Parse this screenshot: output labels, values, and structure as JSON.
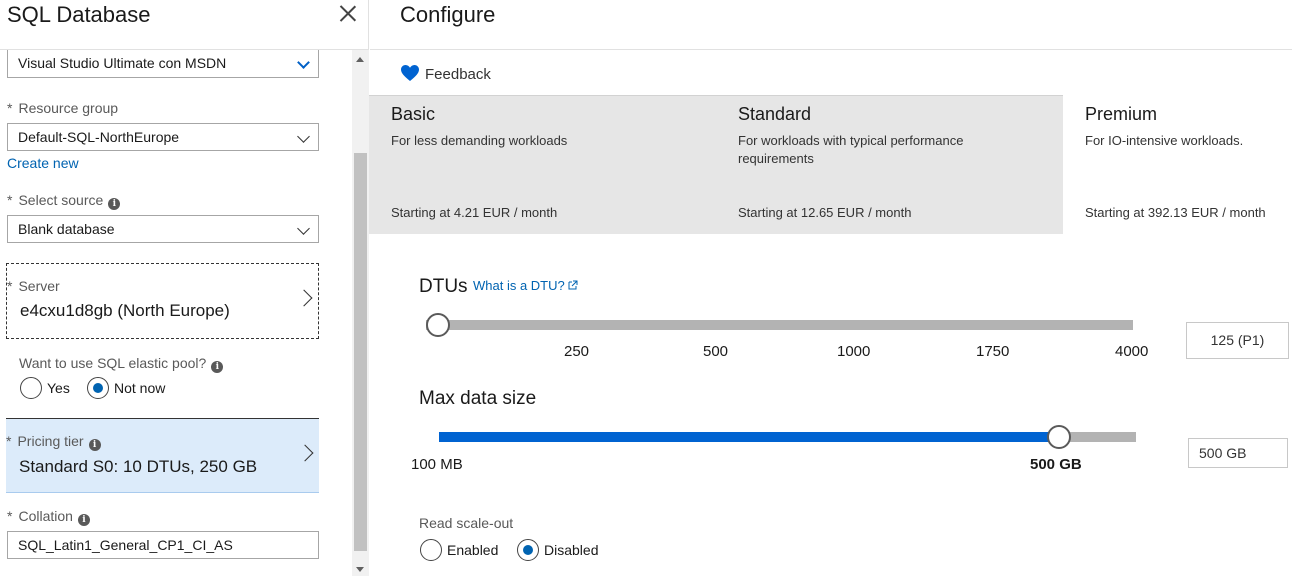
{
  "left_blade": {
    "title": "SQL Database",
    "subscription_value": "Visual Studio Ultimate con MSDN",
    "resource_group": {
      "label": "Resource group",
      "value": "Default-SQL-NorthEurope",
      "create_new": "Create new"
    },
    "select_source": {
      "label": "Select source",
      "value": "Blank database"
    },
    "server": {
      "label": "Server",
      "value": "e4cxu1d8gb (North Europe)"
    },
    "elastic_pool": {
      "label": "Want to use SQL elastic pool?",
      "options": [
        "Yes",
        "Not now"
      ],
      "selected": "Not now"
    },
    "pricing_tier": {
      "label": "Pricing tier",
      "value": "Standard S0: 10 DTUs, 250 GB"
    },
    "collation": {
      "label": "Collation",
      "value": "SQL_Latin1_General_CP1_CI_AS"
    },
    "required_marker": "*"
  },
  "right_blade": {
    "title": "Configure",
    "feedback_label": "Feedback",
    "tiers": [
      {
        "name": "Basic",
        "description": "For less demanding workloads",
        "price": "Starting at 4.21 EUR / month"
      },
      {
        "name": "Standard",
        "description": "For workloads with typical performance requirements",
        "price": "Starting at 12.65 EUR / month"
      },
      {
        "name": "Premium",
        "description": "For IO-intensive workloads.",
        "price": "Starting at 392.13 EUR / month"
      }
    ],
    "selected_tier": "Premium",
    "dtus": {
      "label": "DTUs",
      "help_link": "What is a DTU?",
      "ticks": [
        "250",
        "500",
        "1000",
        "1750",
        "4000"
      ],
      "value": "125 (P1)",
      "slider_fraction": 0
    },
    "max_data_size": {
      "label": "Max data size",
      "min_label": "100 MB",
      "current_label": "500 GB",
      "value": "500 GB",
      "slider_fraction": 0.89
    },
    "read_scale_out": {
      "label": "Read scale-out",
      "options": [
        "Enabled",
        "Disabled"
      ],
      "selected": "Disabled"
    }
  },
  "colors": {
    "accent": "#0063b1",
    "slider_fill": "#0063d1",
    "selected_row": "#dcebfa",
    "tier_gray": "#e6e6e6"
  },
  "icons": [
    "close-icon",
    "chevron-down-icon",
    "chevron-right-icon",
    "info-icon",
    "heart-icon",
    "external-link-icon"
  ]
}
